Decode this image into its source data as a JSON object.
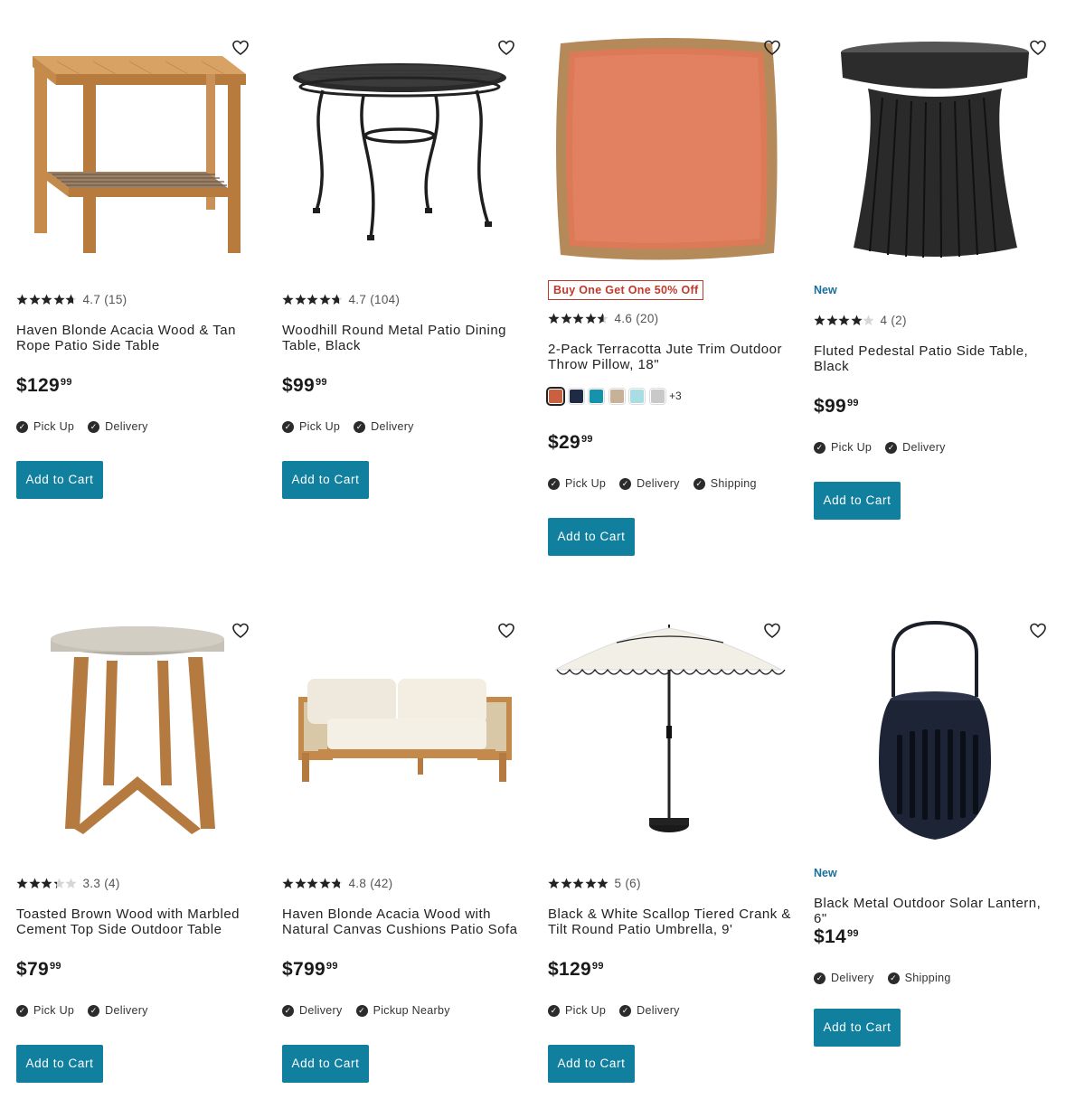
{
  "colors": {
    "accent": "#11809e",
    "promo": "#c0392b",
    "new": "#1a6f9b",
    "star": "#222222"
  },
  "products": [
    {
      "name": "Haven Blonde Acacia Wood & Tan Rope Patio Side Table",
      "rating": 4.7,
      "rating_text": "4.7 (15)",
      "price_dollars": "$129",
      "price_cents": "99",
      "fulfillment": [
        "Pick Up",
        "Delivery"
      ],
      "cart_label": "Add to Cart"
    },
    {
      "name": "Woodhill Round Metal Patio Dining Table, Black",
      "rating": 4.7,
      "rating_text": "4.7 (104)",
      "price_dollars": "$99",
      "price_cents": "99",
      "fulfillment": [
        "Pick Up",
        "Delivery"
      ],
      "cart_label": "Add to Cart"
    },
    {
      "promo": "Buy One Get One 50% Off",
      "name": "2-Pack Terracotta Jute Trim Outdoor Throw Pillow, 18\"",
      "rating": 4.6,
      "rating_text": "4.6 (20)",
      "swatches": [
        "#c9603f",
        "#1f2a44",
        "#1593ad",
        "#c8b297",
        "#a7dde3",
        "#c9c9c9"
      ],
      "swatch_more": "+3",
      "price_dollars": "$29",
      "price_cents": "99",
      "fulfillment": [
        "Pick Up",
        "Delivery",
        "Shipping"
      ],
      "cart_label": "Add to Cart"
    },
    {
      "badge": "New",
      "name": "Fluted Pedestal Patio Side Table, Black",
      "rating": 4,
      "rating_text": "4 (2)",
      "price_dollars": "$99",
      "price_cents": "99",
      "fulfillment": [
        "Pick Up",
        "Delivery"
      ],
      "cart_label": "Add to Cart"
    },
    {
      "name": "Toasted Brown Wood with Marbled Cement Top Side Outdoor Table",
      "rating": 3.3,
      "rating_text": "3.3 (4)",
      "price_dollars": "$79",
      "price_cents": "99",
      "fulfillment": [
        "Pick Up",
        "Delivery"
      ],
      "cart_label": "Add to Cart"
    },
    {
      "name": "Haven Blonde Acacia Wood with Natural Canvas Cushions Patio Sofa",
      "rating": 4.8,
      "rating_text": "4.8 (42)",
      "price_dollars": "$799",
      "price_cents": "99",
      "fulfillment": [
        "Delivery",
        "Pickup Nearby"
      ],
      "cart_label": "Add to Cart"
    },
    {
      "name": "Black & White Scallop Tiered Crank & Tilt Round Patio Umbrella, 9'",
      "rating": 5,
      "rating_text": "5 (6)",
      "price_dollars": "$129",
      "price_cents": "99",
      "fulfillment": [
        "Pick Up",
        "Delivery"
      ],
      "cart_label": "Add to Cart"
    },
    {
      "badge": "New",
      "name": "Black Metal Outdoor Solar Lantern, 6\"",
      "price_dollars": "$14",
      "price_cents": "99",
      "fulfillment": [
        "Delivery",
        "Shipping"
      ],
      "cart_label": "Add to Cart"
    }
  ]
}
